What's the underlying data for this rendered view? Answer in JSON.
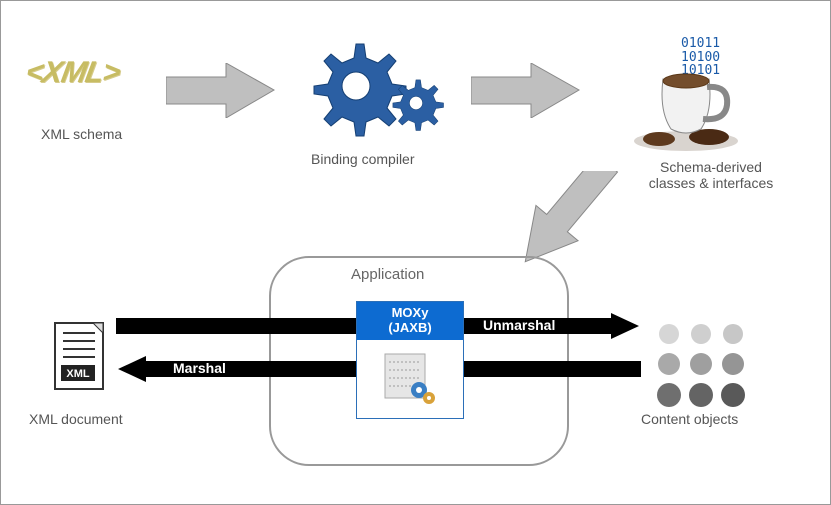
{
  "nodes": {
    "xml_schema_label": "XML schema",
    "binding_compiler_label": "Binding compiler",
    "derived_label_line1": "Schema-derived",
    "derived_label_line2": "classes & interfaces",
    "application_label": "Application",
    "moxy_line1": "MOXy",
    "moxy_line2": "(JAXB)",
    "xml_document_label": "XML document",
    "content_objects_label": "Content objects",
    "xml_logo_text": "<XML>",
    "xml_doc_badge": "XML",
    "binary_line1": "01011",
    "binary_line2": "10100",
    "binary_line3": "10101"
  },
  "arrows": {
    "unmarshal_label": "Unmarshal",
    "marshal_label": "Marshal"
  }
}
